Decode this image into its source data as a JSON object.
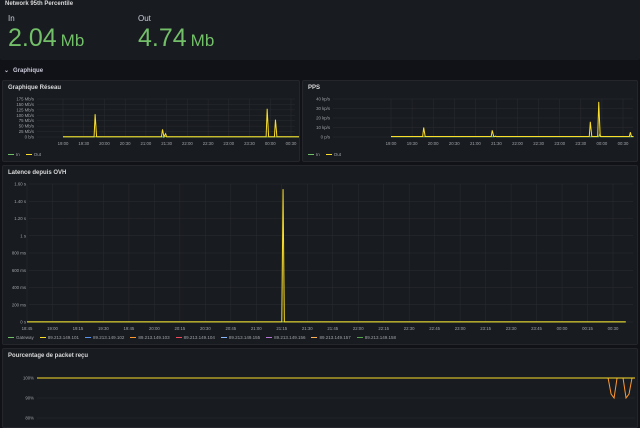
{
  "stats_panel": {
    "title": "Network 95th Percentile",
    "in": {
      "label": "In",
      "value": "2.04",
      "unit": "Mb"
    },
    "out": {
      "label": "Out",
      "value": "4.74",
      "unit": "Mb"
    }
  },
  "row": {
    "title": "Graphique",
    "chevron": "chevron-down-icon"
  },
  "colors": {
    "in": "#73bf69",
    "out": "#fade2a",
    "bg": "#111217",
    "panel": "#181b1f",
    "gateway": "#73bf69",
    "h101": "#fade2a",
    "h102": "#5794f2",
    "h103": "#ff9830",
    "h104": "#f2495c",
    "h155": "#8ab8ff",
    "h156": "#b877d9",
    "h157": "#ffb357",
    "h158": "#56a64b"
  },
  "charts": [
    {
      "title": "Graphique Réseau",
      "chart_data": {
        "type": "line",
        "yticks": [
          "175 Mb/s",
          "150 Mb/s",
          "125 Mb/s",
          "100 Mb/s",
          "75 Mb/s",
          "50 Mb/s",
          "25 Mb/s",
          "0 b/s"
        ],
        "ylim": [
          0,
          175
        ],
        "x": [
          "19:00",
          "19:30",
          "20:00",
          "20:30",
          "21:00",
          "21:30",
          "22:00",
          "22:30",
          "23:00",
          "23:30",
          "00:00",
          "00:30"
        ],
        "series": [
          {
            "name": "In",
            "color_key": "in",
            "points": [
              [
                0,
                0.5
              ],
              [
                1.55,
                0.5
              ],
              [
                1.6,
                2
              ],
              [
                1.65,
                0.5
              ],
              [
                4.9,
                0.5
              ],
              [
                4.95,
                3
              ],
              [
                5.0,
                0.5
              ],
              [
                11.5,
                0.5
              ]
            ]
          },
          {
            "name": "Out",
            "color_key": "out",
            "points": [
              [
                0,
                1
              ],
              [
                1.5,
                1
              ],
              [
                1.55,
                105
              ],
              [
                1.62,
                1
              ],
              [
                4.75,
                1
              ],
              [
                4.8,
                35
              ],
              [
                4.87,
                1
              ],
              [
                4.95,
                15
              ],
              [
                5.0,
                1
              ],
              [
                9.8,
                1
              ],
              [
                9.85,
                130
              ],
              [
                9.92,
                1
              ],
              [
                10.2,
                1
              ],
              [
                10.25,
                80
              ],
              [
                10.32,
                1
              ],
              [
                11.5,
                1
              ]
            ]
          }
        ]
      },
      "legend": [
        "In",
        "Out"
      ]
    },
    {
      "title": "PPS",
      "chart_data": {
        "type": "line",
        "yticks": [
          "40 kp/s",
          "30 kp/s",
          "20 kp/s",
          "10 kp/s",
          "0 p/s"
        ],
        "ylim": [
          0,
          40
        ],
        "x": [
          "19:00",
          "19:30",
          "20:00",
          "20:30",
          "21:00",
          "21:30",
          "22:00",
          "22:30",
          "23:00",
          "23:30",
          "00:00",
          "00:30"
        ],
        "series": [
          {
            "name": "In",
            "color_key": "in",
            "points": [
              [
                0,
                0.2
              ],
              [
                4.9,
                0.2
              ],
              [
                4.95,
                1
              ],
              [
                5.0,
                0.2
              ],
              [
                9.85,
                0.2
              ],
              [
                9.9,
                3
              ],
              [
                9.95,
                0.2
              ],
              [
                11.5,
                0.2
              ]
            ]
          },
          {
            "name": "Out",
            "color_key": "out",
            "points": [
              [
                0,
                0.5
              ],
              [
                1.5,
                0.5
              ],
              [
                1.55,
                10
              ],
              [
                1.62,
                0.5
              ],
              [
                4.75,
                0.5
              ],
              [
                4.8,
                7
              ],
              [
                4.87,
                0.5
              ],
              [
                9.4,
                0.5
              ],
              [
                9.45,
                16
              ],
              [
                9.52,
                0.5
              ],
              [
                9.8,
                0.5
              ],
              [
                9.85,
                37
              ],
              [
                9.92,
                0.5
              ],
              [
                11.3,
                0.5
              ],
              [
                11.35,
                5
              ],
              [
                11.4,
                0.5
              ],
              [
                11.5,
                0.5
              ]
            ]
          }
        ]
      },
      "legend": [
        "In",
        "Out"
      ]
    },
    {
      "title": "Latence depuis OVH",
      "chart_data": {
        "type": "line",
        "yticks": [
          "1.60 s",
          "1.40 s",
          "1.20 s",
          "1 s",
          "800 ms",
          "600 ms",
          "400 ms",
          "200 ms",
          "0 s"
        ],
        "ylim": [
          0,
          1600
        ],
        "x": [
          "18:45",
          "19:00",
          "19:15",
          "19:30",
          "19:45",
          "20:00",
          "20:15",
          "20:30",
          "20:45",
          "21:00",
          "21:15",
          "21:30",
          "21:45",
          "22:00",
          "22:15",
          "22:30",
          "22:45",
          "23:00",
          "23:15",
          "23:30",
          "23:45",
          "00:00",
          "00:15",
          "00:30"
        ],
        "series": [
          {
            "name": "Gateway",
            "color_key": "gateway",
            "points": [
              [
                0,
                1
              ],
              [
                23.5,
                1
              ]
            ]
          },
          {
            "name": "89.213.149.101",
            "color_key": "h101",
            "points": [
              [
                0,
                2
              ],
              [
                10.0,
                2
              ],
              [
                10.05,
                1540
              ],
              [
                10.1,
                2
              ],
              [
                23.5,
                2
              ]
            ]
          }
        ]
      },
      "legend": [
        "Gateway",
        "89.213.149.101",
        "89.213.149.102",
        "89.213.149.103",
        "89.213.149.104",
        "89.213.149.155",
        "89.213.149.156",
        "89.213.149.157",
        "89.213.149.158"
      ]
    },
    {
      "title": "Pourcentage de packet reçu",
      "chart_data": {
        "type": "line",
        "yticks": [
          "100%",
          "90%",
          "80%"
        ],
        "ylim": [
          78,
          103
        ],
        "series": [
          {
            "name": "Gateway",
            "color_key": "h103",
            "points": [
              [
                0,
                100
              ],
              [
                0.955,
                100
              ],
              [
                0.96,
                92
              ],
              [
                0.965,
                90
              ],
              [
                0.97,
                100
              ],
              [
                0.98,
                100
              ],
              [
                0.985,
                90
              ],
              [
                0.99,
                92
              ],
              [
                0.995,
                100
              ],
              [
                1,
                100
              ]
            ]
          },
          {
            "name": "89.213.149.101",
            "color_key": "h101",
            "points": [
              [
                0,
                100
              ],
              [
                1,
                100
              ]
            ]
          }
        ]
      }
    }
  ]
}
